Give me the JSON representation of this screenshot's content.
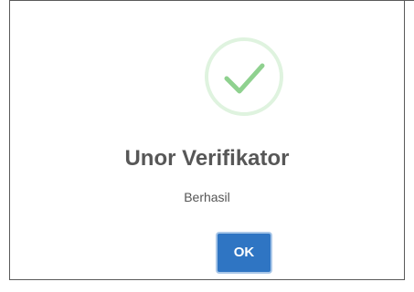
{
  "dialog": {
    "icon": "checkmark-circle-icon",
    "title": "Unor Verifikator",
    "message": "Berhasil",
    "ok_label": "OK"
  },
  "colors": {
    "success_green": "#8fd18f",
    "success_ring": "#dff3df",
    "button_blue": "#2f75c3",
    "title_text": "#575757"
  }
}
